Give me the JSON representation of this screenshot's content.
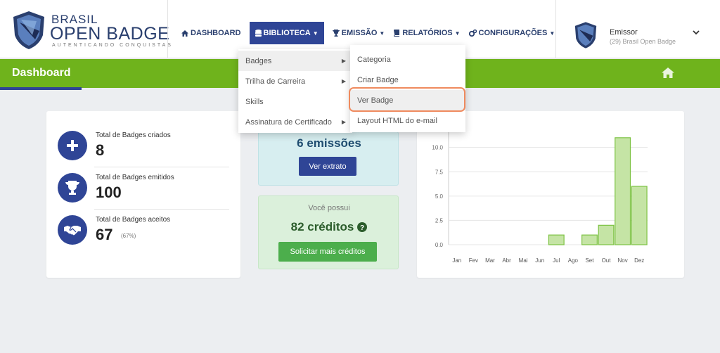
{
  "brand": {
    "line1": "BRASIL",
    "line2": "OPEN BADGE",
    "tagline": "AUTENTICANDO CONQUISTAS"
  },
  "nav": [
    {
      "label": "DASHBOARD",
      "icon": "home-icon",
      "caret": false
    },
    {
      "label": "BIBLIOTECA",
      "icon": "database-icon",
      "caret": true
    },
    {
      "label": "EMISSÃO",
      "icon": "trophy-icon",
      "caret": true
    },
    {
      "label": "RELATÓRIOS",
      "icon": "book-icon",
      "caret": true
    },
    {
      "label": "CONFIGURAÇÕES",
      "icon": "cogs-icon",
      "caret": true
    }
  ],
  "user": {
    "role": "Emissor",
    "org": "(29) Brasil Open Badge"
  },
  "page": {
    "title": "Dashboard"
  },
  "stats": [
    {
      "label": "Total de Badges criados",
      "value": "8",
      "icon": "plus-icon"
    },
    {
      "label": "Total de Badges emitidos",
      "value": "100",
      "icon": "trophy-icon"
    },
    {
      "label": "Total de Badges aceitos",
      "value": "67",
      "pct": "(67%)",
      "icon": "handshake-icon"
    }
  ],
  "emissions": {
    "value": "6 emissões",
    "button": "Ver extrato"
  },
  "credits": {
    "intro": "Você possui",
    "value": "82 créditos",
    "button": "Solicitar mais créditos"
  },
  "menus": {
    "biblioteca": [
      "Badges",
      "Trilha de Carreira",
      "Skills",
      "Assinatura de Certificado"
    ],
    "badges": [
      "Categoria",
      "Criar Badge",
      "Ver Badge",
      "Layout HTML do e-mail"
    ]
  },
  "colors": {
    "primary": "#2f4596",
    "green": "#6fb31c",
    "bar": "#c5e4a5",
    "bar_stroke": "#7cc242",
    "highlight_ring": "#ef8a5e"
  },
  "chart_data": {
    "type": "bar",
    "categories": [
      "Jan",
      "Fev",
      "Mar",
      "Abr",
      "Mai",
      "Jun",
      "Jul",
      "Ago",
      "Set",
      "Out",
      "Nov",
      "Dez"
    ],
    "values": [
      0,
      0,
      0,
      0,
      0,
      0,
      1,
      0,
      1,
      2,
      11,
      6
    ],
    "yticks": [
      "0.0",
      "2.5",
      "5.0",
      "7.5",
      "10.0"
    ],
    "ylim": [
      0,
      12
    ],
    "grid": true
  }
}
